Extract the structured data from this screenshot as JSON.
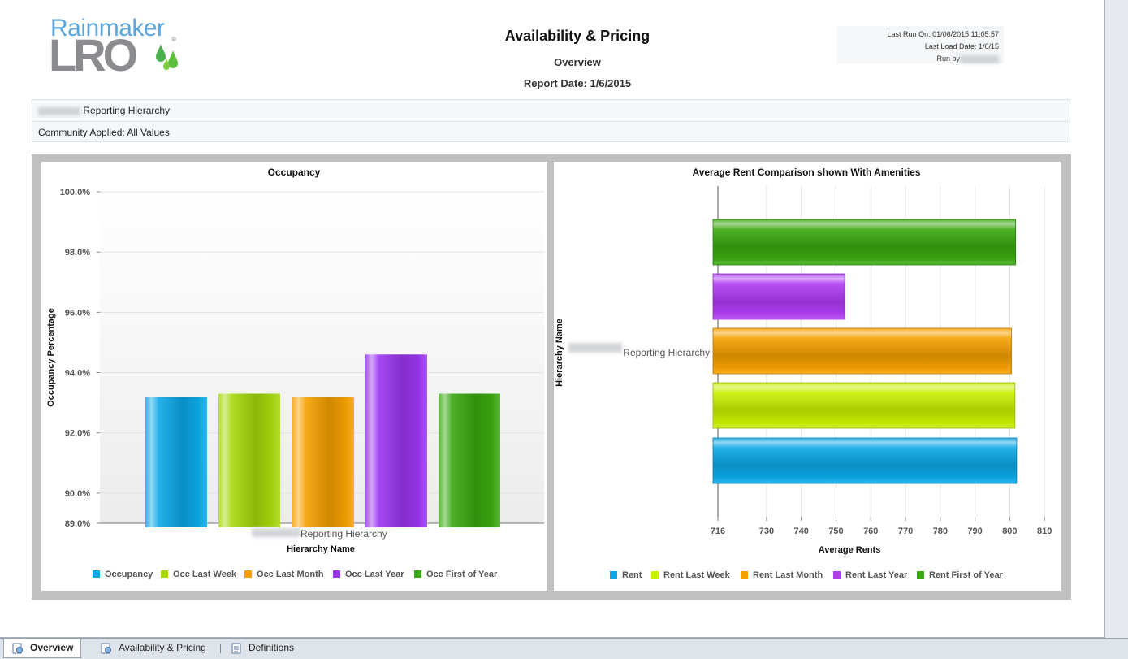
{
  "logo": {
    "line1": "Rainmaker",
    "line2": "LRO",
    "mark": "®"
  },
  "header": {
    "title": "Availability & Pricing",
    "subtitle": "Overview",
    "report_date": "Report Date: 1/6/2015"
  },
  "run_info": {
    "last_run": "Last Run On: 01/06/2015 11:05:57",
    "last_load": "Last Load Date: 1/6/15",
    "run_by": "Run by"
  },
  "filters": {
    "hierarchy": "Reporting Hierarchy",
    "community": "Community Applied: All Values"
  },
  "colors": {
    "blue": "#0aa8e6",
    "lime": "#a6d80a",
    "orange": "#f5a000",
    "purple": "#9b36f0",
    "green": "#3aa810"
  },
  "chart_data": [
    {
      "type": "bar",
      "title": "Occupancy",
      "xlabel": "Hierarchy Name",
      "ylabel": "Occupancy Percentage",
      "category": "Reporting Hierarchy",
      "ylim": [
        89.0,
        100.0
      ],
      "yticks": [
        "100.0%",
        "98.0%",
        "96.0%",
        "94.0%",
        "92.0%",
        "90.0%",
        "89.0%"
      ],
      "ytick_values": [
        100,
        98,
        96,
        94,
        92,
        90,
        89
      ],
      "series": [
        {
          "name": "Occupancy",
          "value": 93.2,
          "color": "#0aa8e6"
        },
        {
          "name": "Occ Last Week",
          "value": 93.3,
          "color": "#a6d80a"
        },
        {
          "name": "Occ Last Month",
          "value": 93.2,
          "color": "#f5a000"
        },
        {
          "name": "Occ Last Year",
          "value": 94.6,
          "color": "#9b36f0"
        },
        {
          "name": "Occ First of Year",
          "value": 93.3,
          "color": "#3aa810"
        }
      ],
      "grid": true,
      "legend": "bottom"
    },
    {
      "type": "bar",
      "orientation": "horizontal",
      "title": "Average Rent Comparison shown With Amenities",
      "xlabel": "Average Rents",
      "ylabel": "Hierarchy Name",
      "category": "Reporting Hierarchy",
      "xlim": [
        716,
        813
      ],
      "xticks": [
        "716",
        "730",
        "740",
        "750",
        "760",
        "770",
        "780",
        "790",
        "800",
        "810"
      ],
      "xtick_values": [
        716,
        730,
        740,
        750,
        760,
        770,
        780,
        790,
        800,
        810
      ],
      "series": [
        {
          "name": "Rent",
          "value": 802,
          "color": "#0aa8e6"
        },
        {
          "name": "Rent Last Week",
          "value": 801.5,
          "color": "#c9f000"
        },
        {
          "name": "Rent Last Month",
          "value": 800.5,
          "color": "#f5a000"
        },
        {
          "name": "Rent Last Year",
          "value": 752.5,
          "color": "#b03cf5"
        },
        {
          "name": "Rent First of Year",
          "value": 801.7,
          "color": "#3aa810"
        }
      ],
      "grid": true,
      "legend": "bottom"
    }
  ],
  "tabs": [
    {
      "label": "Overview"
    },
    {
      "label": "Availability & Pricing"
    },
    {
      "label": "Definitions"
    }
  ]
}
